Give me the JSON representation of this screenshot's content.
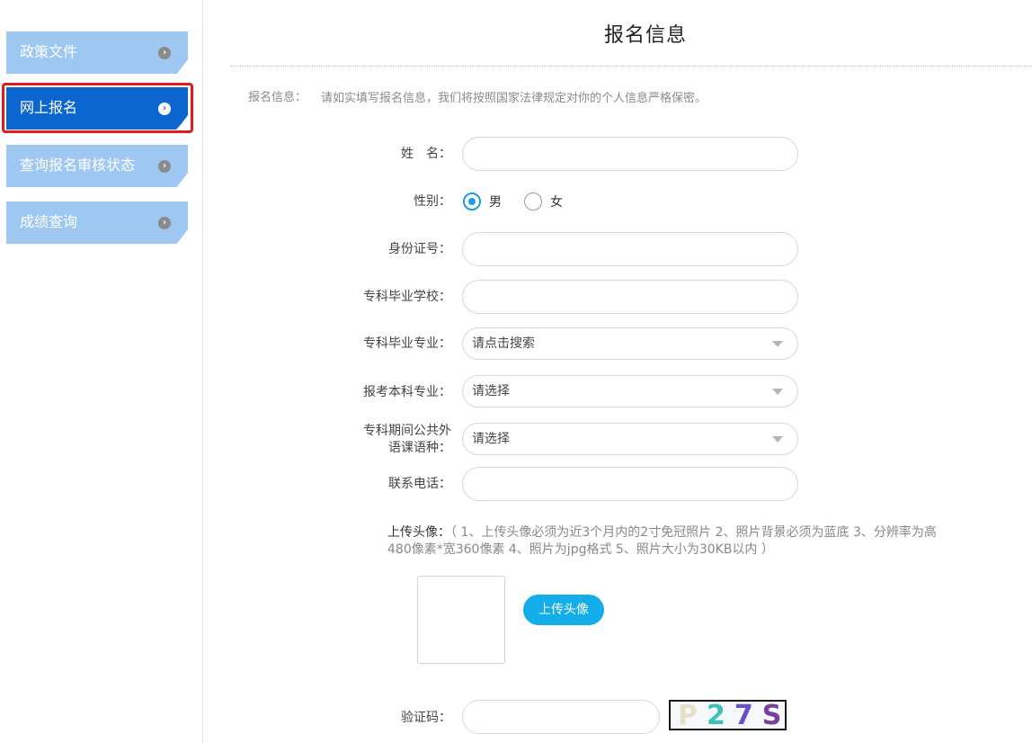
{
  "sidebar": {
    "items": [
      {
        "label": "政策文件"
      },
      {
        "label": "网上报名",
        "active": true
      },
      {
        "label": "查询报名审核状态"
      },
      {
        "label": "成绩查询"
      }
    ],
    "chevron_glyph": "›"
  },
  "main": {
    "title": "报名信息",
    "intro_label": "报名信息：",
    "intro_text": "请如实填写报名信息，我们将按照国家法律规定对你的个人信息严格保密。"
  },
  "form": {
    "name_label": "姓　名：",
    "gender_label": "性别：",
    "gender_options": [
      {
        "label": "男",
        "checked": true
      },
      {
        "label": "女",
        "checked": false
      }
    ],
    "id_label": "身份证号：",
    "school_label": "专科毕业学校：",
    "major_label": "专科毕业专业：",
    "major_value": "请点击搜索",
    "target_major_label": "报考本科专业：",
    "target_major_value": "请选择",
    "language_label_line1": "专科期间公共外",
    "language_label_line2": "语课语种：",
    "language_value": "请选择",
    "phone_label": "联系电话：",
    "upload_title": "上传头像：",
    "upload_note": "（ 1、上传头像必须为近3个月内的2寸免冠照片 2、照片背景必须为蓝底 3、分辨率为高480像素*宽360像素 4、照片为jpg格式 5、照片大小为30KB以内 ）",
    "upload_button": "上传头像",
    "captcha_label": "验证码：",
    "captcha_text": "P27S"
  },
  "colors": {
    "nav_inactive": "#9ec8f1",
    "nav_active": "#0b67cf",
    "highlight_frame": "#e21b1b",
    "radio_accent": "#1a9ee8",
    "upload_button": "#13aee9"
  }
}
